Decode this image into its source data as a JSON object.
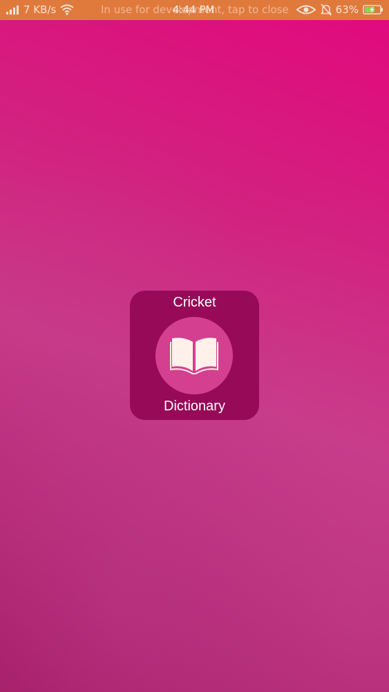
{
  "status_bar": {
    "network_speed": "7 KB/s",
    "notification_text": "In use for development, tap to close",
    "time": "4:44 PM",
    "battery_percent": "63%",
    "icons": [
      "signal-icon",
      "wifi-icon",
      "eye-icon",
      "bell-muted-icon",
      "battery-charging-icon"
    ],
    "background_color": "#e07a3c"
  },
  "splash": {
    "title_top": "Cricket",
    "title_bottom": "Dictionary",
    "icon": "open-book-icon",
    "tile_color": "#970a57",
    "circle_color": "#d4408f",
    "background_colors": [
      "#e2087e",
      "#c83a88",
      "#a31a63"
    ]
  }
}
